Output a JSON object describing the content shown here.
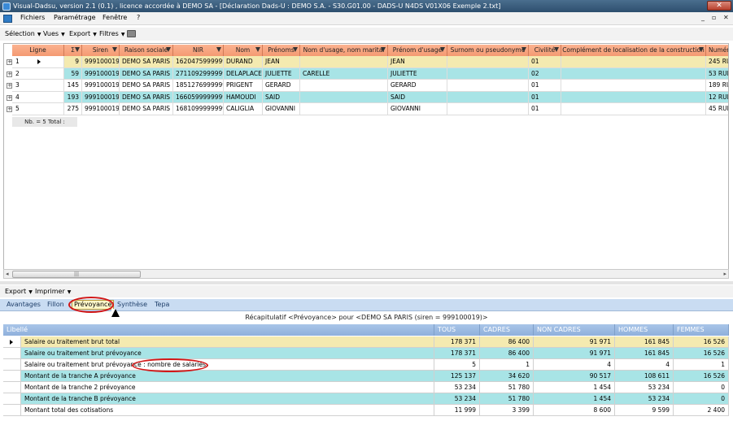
{
  "window": {
    "title": "Visual-Dadsu, version 2.1 (0.1) , licence accordée à DEMO SA - [Déclaration Dads-U : DEMO S.A. - S30.G01.00 - DADS-U N4DS V01X06 Exemple 2.txt]",
    "close_label": "✕"
  },
  "menu": {
    "items": [
      "Fichiers",
      "Paramétrage",
      "Fenêtre",
      "?"
    ],
    "win_controls": [
      "_",
      "▫",
      "✕"
    ]
  },
  "toolbar": {
    "items": [
      "Sélection",
      "Vues",
      "Export",
      "Filtres"
    ]
  },
  "grid": {
    "columns": [
      "Ligne",
      "Σ",
      "Siren",
      "Raison sociale",
      "NIR",
      "Nom",
      "Prénoms",
      "Nom d'usage, nom marital",
      "Prénom d'usage",
      "Surnom ou pseudonyme",
      "Civilité",
      "Complément de localisation de la construction",
      "Numéro"
    ],
    "rows": [
      {
        "ligne": "1",
        "sigma": "9",
        "siren": "999100019",
        "raison": "DEMO SA PARIS",
        "nir": "1620475999999",
        "nom": "DURAND",
        "prenoms": "JEAN",
        "nom_usage": "",
        "prenom_usage": "JEAN",
        "surnom": "",
        "civilite": "01",
        "complement": "",
        "numero": "245 RU"
      },
      {
        "ligne": "2",
        "sigma": "59",
        "siren": "999100019",
        "raison": "DEMO SA PARIS",
        "nir": "2711092999999",
        "nom": "DELAPLACE",
        "prenoms": "JULIETTE",
        "nom_usage": "CARELLE",
        "prenom_usage": "JULIETTE",
        "surnom": "",
        "civilite": "02",
        "complement": "",
        "numero": "53 RUE"
      },
      {
        "ligne": "3",
        "sigma": "145",
        "siren": "999100019",
        "raison": "DEMO SA PARIS",
        "nir": "1851276999999",
        "nom": "PRIGENT",
        "prenoms": "GERARD",
        "nom_usage": "",
        "prenom_usage": "GERARD",
        "surnom": "",
        "civilite": "01",
        "complement": "",
        "numero": "189 RU"
      },
      {
        "ligne": "4",
        "sigma": "193",
        "siren": "999100019",
        "raison": "DEMO SA PARIS",
        "nir": "1660599999999",
        "nom": "HAMOUDI",
        "prenoms": "SAID",
        "nom_usage": "",
        "prenom_usage": "SAID",
        "surnom": "",
        "civilite": "01",
        "complement": "",
        "numero": "12 RUE"
      },
      {
        "ligne": "5",
        "sigma": "275",
        "siren": "999100019",
        "raison": "DEMO SA PARIS",
        "nir": "1681099999999",
        "nom": "CALIGLIA",
        "prenoms": "GIOVANNI",
        "nom_usage": "",
        "prenom_usage": "GIOVANNI",
        "surnom": "",
        "civilite": "01",
        "complement": "",
        "numero": "45 RUE"
      }
    ],
    "summary": "Nb. =    5 Total :"
  },
  "toolbar2": {
    "items": [
      "Export",
      "Imprimer"
    ]
  },
  "tabs": [
    "Avantages",
    "Fillon",
    "Prévoyance",
    "Synthèse",
    "Tepa"
  ],
  "recap": {
    "title": "Récapitulatif <Prévoyance> pour <DEMO SA PARIS (siren = 999100019)>"
  },
  "recap_grid": {
    "columns": [
      "Libellé",
      "TOUS",
      "CADRES",
      "NON CADRES",
      "HOMMES",
      "FEMMES"
    ],
    "rows": [
      {
        "label": "Salaire ou traitement brut total",
        "values": [
          "178 371",
          "86 400",
          "91 971",
          "161 845",
          "16 526"
        ]
      },
      {
        "label": "Salaire ou traitement brut prévoyance",
        "values": [
          "178 371",
          "86 400",
          "91 971",
          "161 845",
          "16 526"
        ]
      },
      {
        "label": "Salaire ou traitement brut prévoyance : nombre de salariés",
        "values": [
          "5",
          "1",
          "4",
          "4",
          "1"
        ]
      },
      {
        "label": "Montant de la tranche A prévoyance",
        "values": [
          "125 137",
          "34 620",
          "90 517",
          "108 611",
          "16 526"
        ]
      },
      {
        "label": "Montant de la tranche 2 prévoyance",
        "values": [
          "53 234",
          "51 780",
          "1 454",
          "53 234",
          "0"
        ]
      },
      {
        "label": "Montant de la tranche B prévoyance",
        "values": [
          "53 234",
          "51 780",
          "1 454",
          "53 234",
          "0"
        ]
      },
      {
        "label": "Montant total des cotisations",
        "values": [
          "11 999",
          "3 399",
          "8 600",
          "9 599",
          "2 400"
        ]
      }
    ]
  },
  "colors": {
    "row_yellow": "#f4eab0",
    "row_cyan": "#a8e4e6",
    "header_orange": "#f6a47e",
    "header_blue": "#9bbbe2",
    "highlight_red": "#d21818"
  }
}
